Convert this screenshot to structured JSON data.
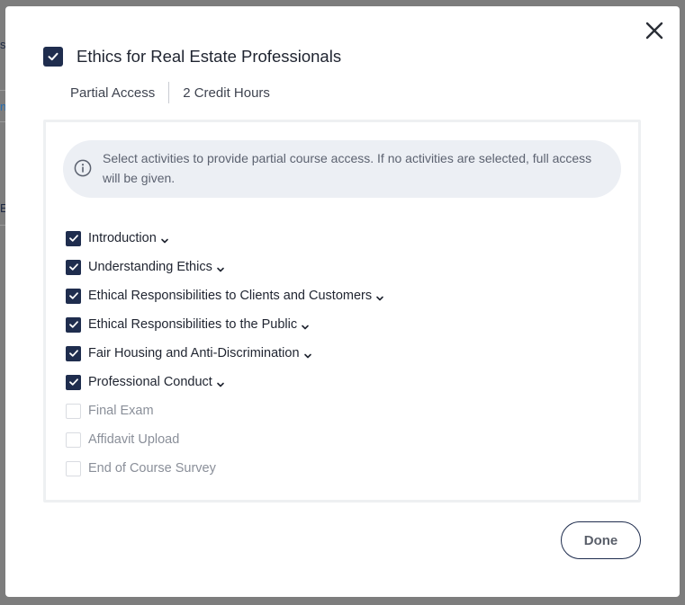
{
  "modal": {
    "title": "Ethics for Real Estate Professionals",
    "title_checked": true,
    "access_label": "Partial Access",
    "credit_label": "2 Credit Hours",
    "info_text": "Select activities to provide partial course access. If no activities are selected, full access will be given.",
    "done_label": "Done",
    "items": [
      {
        "label": "Introduction",
        "checked": true,
        "expandable": true
      },
      {
        "label": "Understanding Ethics",
        "checked": true,
        "expandable": true
      },
      {
        "label": "Ethical Responsibilities to Clients and Customers",
        "checked": true,
        "expandable": true
      },
      {
        "label": "Ethical Responsibilities to the Public",
        "checked": true,
        "expandable": true
      },
      {
        "label": "Fair Housing and Anti-Discrimination",
        "checked": true,
        "expandable": true
      },
      {
        "label": "Professional Conduct",
        "checked": true,
        "expandable": true
      },
      {
        "label": "Final Exam",
        "checked": false,
        "expandable": false
      },
      {
        "label": "Affidavit Upload",
        "checked": false,
        "expandable": false
      },
      {
        "label": "End of Course Survey",
        "checked": false,
        "expandable": false
      }
    ]
  },
  "background": {
    "fragments": [
      "s",
      "n",
      "E"
    ]
  },
  "colors": {
    "accent": "#1f2d4e",
    "info_bg": "#eceff4"
  }
}
